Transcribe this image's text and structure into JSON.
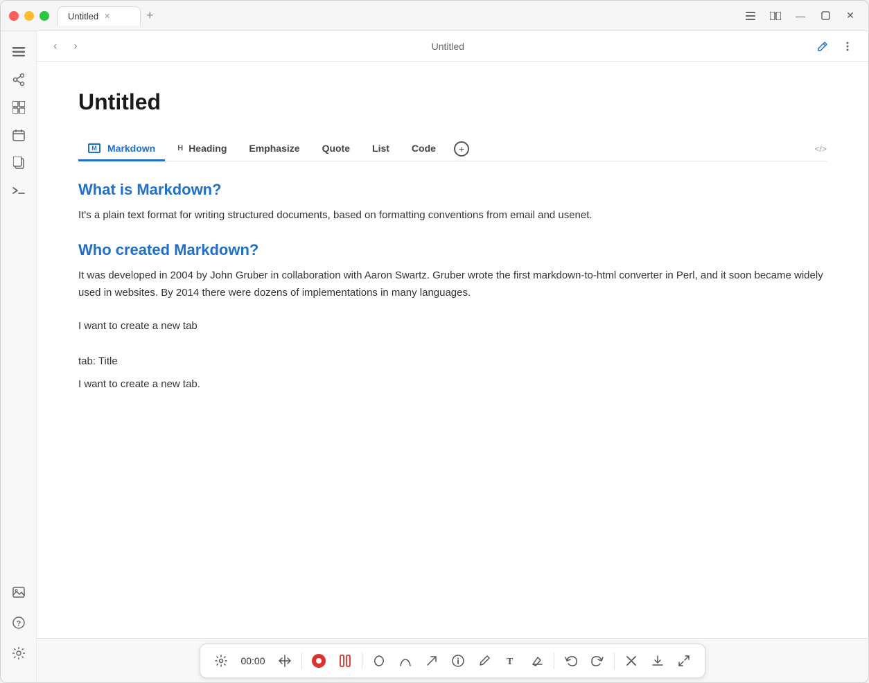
{
  "window": {
    "tab_title": "Untitled",
    "title": "Untitled"
  },
  "topbar": {
    "title": "Untitled",
    "edit_icon": "✎",
    "more_icon": "⋮"
  },
  "document": {
    "title": "Untitled",
    "toolbar_tabs": [
      {
        "label": "Markdown",
        "active": true,
        "icon": "box",
        "prefix": ""
      },
      {
        "label": "Heading",
        "active": false,
        "icon": "",
        "prefix": "H"
      },
      {
        "label": "Emphasize",
        "active": false,
        "icon": "",
        "prefix": ""
      },
      {
        "label": "Quote",
        "active": false,
        "icon": "",
        "prefix": ""
      },
      {
        "label": "List",
        "active": false,
        "icon": "",
        "prefix": ""
      },
      {
        "label": "Code",
        "active": false,
        "icon": "",
        "prefix": ""
      }
    ],
    "sections": [
      {
        "heading": "What is Markdown?",
        "body": "It's a plain text format for writing structured documents, based on formatting conventions from email and usenet."
      },
      {
        "heading": "Who created Markdown?",
        "body": "It was developed in 2004 by John Gruber in collaboration with Aaron Swartz. Gruber wrote the first markdown-to-html converter in Perl, and it soon became widely used in websites. By 2014 there were dozens of implementations in many languages."
      }
    ],
    "plain_lines": [
      "I want to create a new tab",
      "",
      "tab: Title",
      "I want to create a new tab."
    ]
  },
  "bottom_toolbar": {
    "timer": "00:00",
    "buttons": [
      "gear",
      "move",
      "record",
      "pause",
      "lasso",
      "curve",
      "arrow",
      "info",
      "pen",
      "text",
      "eraser",
      "undo",
      "redo",
      "close",
      "download",
      "expand"
    ]
  },
  "sidebar": {
    "icons": [
      "sidebar-toggle",
      "share",
      "grid",
      "calendar",
      "copy",
      "terminal"
    ],
    "bottom_icons": [
      "image-placeholder",
      "help",
      "settings"
    ]
  }
}
